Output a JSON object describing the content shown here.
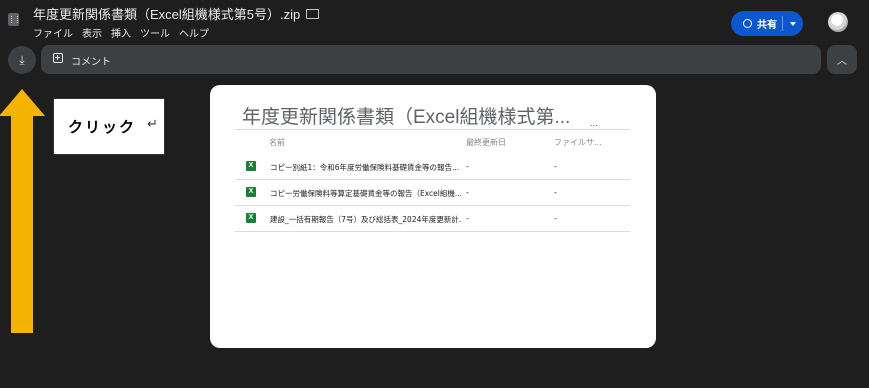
{
  "header": {
    "title": "年度更新関係書類（Excel組機様式第5号）.zip",
    "menu": [
      "ファイル",
      "表示",
      "挿入",
      "ツール",
      "ヘルプ"
    ],
    "share_label": "共有"
  },
  "toolbar": {
    "comment_label": "コメント"
  },
  "annotation": {
    "callout_text": "クリック",
    "callout_mark": "↵"
  },
  "panel": {
    "title": "年度更新関係書類（Excel組機様式第...",
    "dots": "...",
    "columns": [
      "名前",
      "最終更新日",
      "ファイルサ..."
    ],
    "rows": [
      {
        "icon": "X",
        "name": "コピー別紙1：令和6年度労働保険料基礎賃金等の報告...",
        "modified": "-",
        "size": "-"
      },
      {
        "icon": "X",
        "name": "コピー労働保険料等算定基礎賃金等の報告（Excel組機...",
        "modified": "-",
        "size": "-"
      },
      {
        "icon": "X",
        "name": "建設_一括有期報告（7号）及び総括表_2024年度更新計...",
        "modified": "-",
        "size": "-"
      }
    ]
  },
  "colors": {
    "accent": "#0b57d0",
    "arrow": "#f6b400",
    "excel": "#188038",
    "background": "#1e1e1e"
  }
}
